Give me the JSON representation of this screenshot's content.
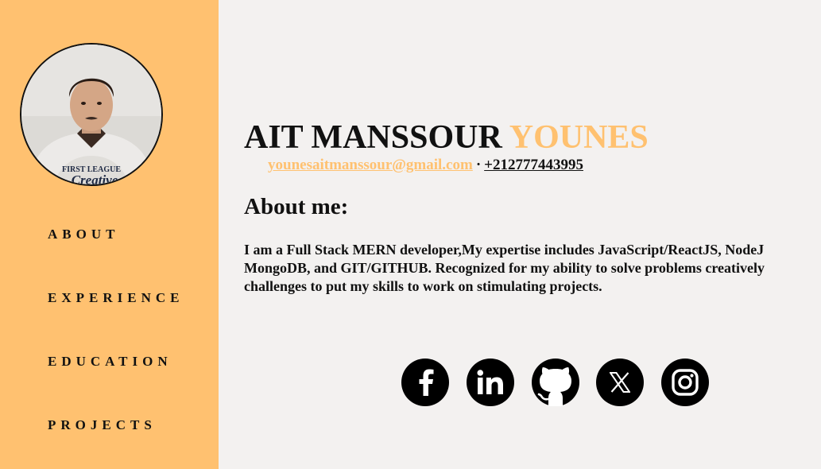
{
  "sidebar": {
    "nav": [
      {
        "label": "ABOUT"
      },
      {
        "label": "EXPERIENCE"
      },
      {
        "label": "EDUCATION"
      },
      {
        "label": "PROJECTS"
      }
    ]
  },
  "profile": {
    "first_name": "AIT MANSSOUR",
    "last_name": "YOUNES",
    "email": "younesaitmanssour@gmail.com",
    "separator": "·",
    "phone": "+212777443995"
  },
  "about": {
    "title": "About me:",
    "lines": [
      "I am a Full Stack MERN developer,My expertise includes JavaScript/ReactJS, NodeJ",
      "MongoDB, and GIT/GITHUB. Recognized for my ability to solve problems creatively",
      "challenges to put my skills to work on stimulating projects."
    ]
  },
  "social": {
    "icons": [
      "facebook-icon",
      "linkedin-icon",
      "github-icon",
      "x-icon",
      "instagram-icon"
    ]
  },
  "colors": {
    "accent": "#ffc170",
    "background": "#f3f1f0",
    "text": "#111111"
  }
}
